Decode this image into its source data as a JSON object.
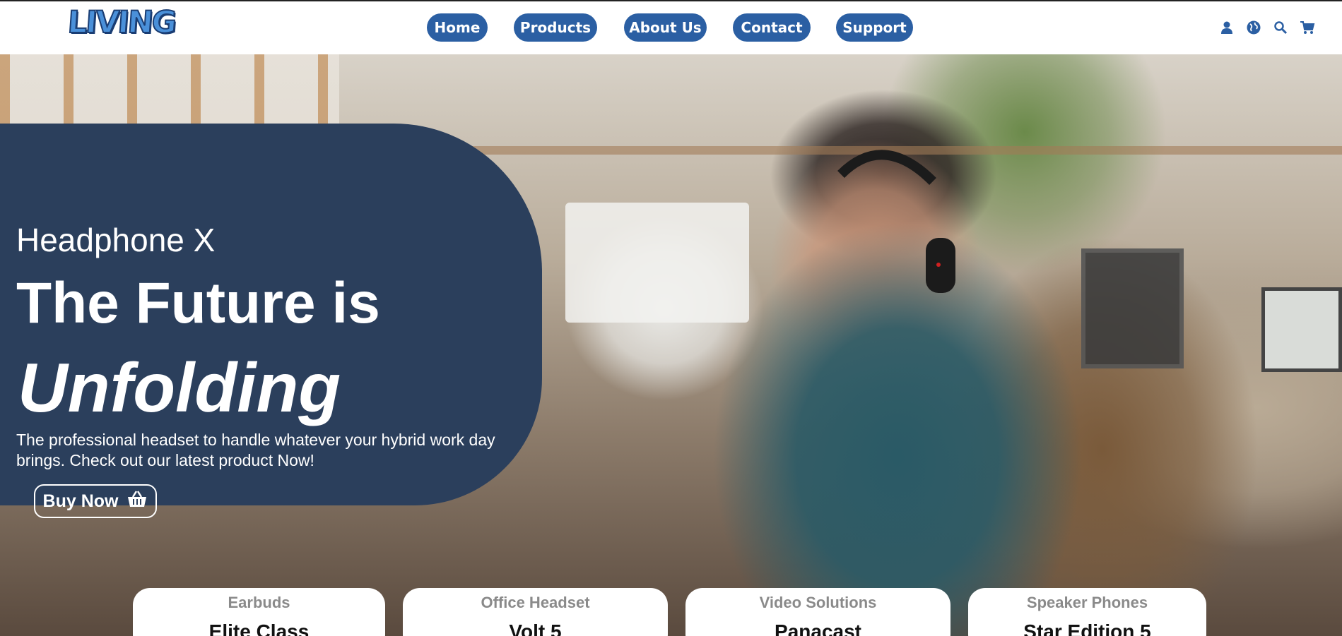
{
  "header": {
    "logo_text": "LIVING",
    "nav": [
      {
        "label": "Home"
      },
      {
        "label": "Products"
      },
      {
        "label": "About Us"
      },
      {
        "label": "Contact"
      },
      {
        "label": "Support"
      }
    ],
    "icons": [
      "user-icon",
      "globe-icon",
      "search-icon",
      "cart-icon"
    ],
    "nav_color": "#2b5fa3"
  },
  "hero": {
    "kicker": "Headphone X",
    "title_line1": "The Future is",
    "title_line2": "Unfolding",
    "description": "The professional headset to handle whatever your hybrid work day brings. Check out our latest product Now!",
    "cta_label": "Buy Now",
    "cta_icon": "basket-icon",
    "panel_color": "#2b3f5c"
  },
  "cards": [
    {
      "category": "Earbuds",
      "name": "Elite Class"
    },
    {
      "category": "Office Headset",
      "name": "Volt 5"
    },
    {
      "category": "Video Solutions",
      "name": "Panacast"
    },
    {
      "category": "Speaker Phones",
      "name": "Star Edition 5"
    }
  ]
}
